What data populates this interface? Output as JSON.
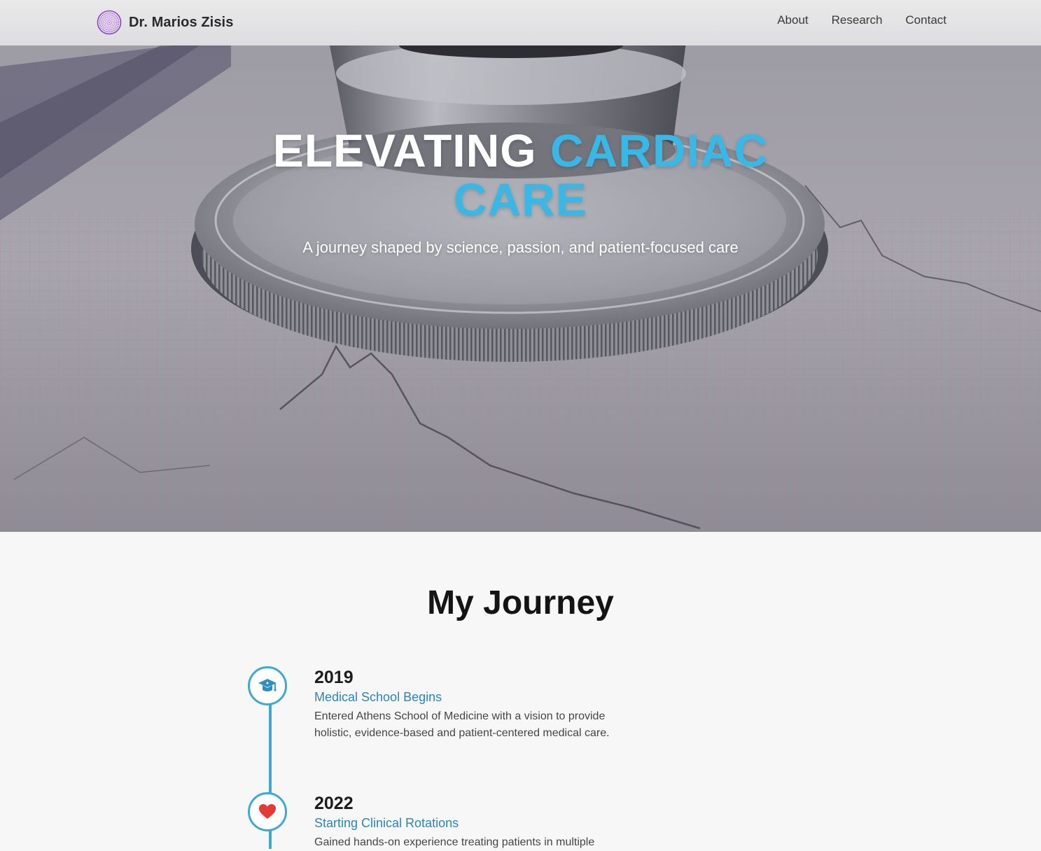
{
  "brand": {
    "name": "Dr. Marios Zisis",
    "logo_icon": "concentric-circles-logo-icon"
  },
  "nav": {
    "links": [
      "About",
      "Research",
      "Contact"
    ]
  },
  "hero": {
    "title_white": "ELEVATING",
    "title_accent_1": "CARDIAC",
    "title_accent_2": "CARE",
    "subtitle": "A journey shaped by science, passion, and patient-focused care",
    "background_icon": "stethoscope-ecg-photo"
  },
  "journey": {
    "title": "My Journey",
    "items": [
      {
        "year": "2019",
        "heading": "Medical School Begins",
        "description": "Entered Athens School of Medicine with a vision to provide holistic, evidence-based and patient-centered medical care.",
        "icon": "graduation-cap-icon"
      },
      {
        "year": "2022",
        "heading": "Starting Clinical Rotations",
        "description": "Gained hands-on experience treating patients in multiple",
        "icon": "heart-icon"
      }
    ]
  },
  "colors": {
    "accent": "#38b8e6",
    "timeline": "#3fa9d0",
    "heading_link": "#2a86b8",
    "logo": "#8a3fd6",
    "heart": "#e53935"
  }
}
